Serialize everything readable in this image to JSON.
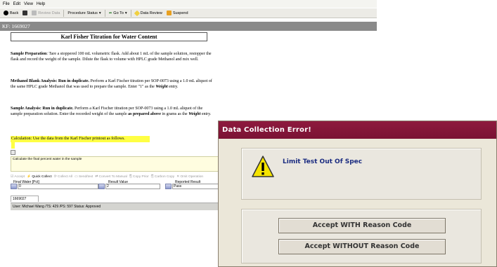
{
  "app": {
    "menu": [
      "File",
      "Edit",
      "View",
      "Help"
    ],
    "toolbar": {
      "back": "Back",
      "reviewdata": "Review Data",
      "procedure_status": "Procedure Status",
      "goto": "Go To",
      "data_review": "Data Review",
      "suspend": "Suspend"
    },
    "record_id": "KF: 1669027",
    "doc_title": "Karl Fisher Titration for Water Content",
    "sections": {
      "sample_prep_head": "Sample Preparation",
      "sample_prep_body": ":  Tare a stoppered 100 mL volumetric flask.  Add about 1 mL of the sample solution, restopper the flask and record the weight of the sample.  Dilute the flask to volume with HPLC grade Methanol and mix well.",
      "blank_head": "Methanol Blank Analysis:  Run in duplicate.",
      "blank_body_1": "  Perform a Karl Fischer titration per SOP-0073 using a 1.0 mL aliquot of the same HPLC grade Methanol that was used to prepare the sample. Enter \"1\" as the ",
      "blank_weight": "Weight",
      "blank_body_2": " entry.",
      "analysis_head": "Sample Analysis:  Run in duplicate.",
      "analysis_body_1": "  Perform a Karl Fischer titration per SOP-0073 using a 1.0 mL aliquot of the sample preparation solution.  Enter the recorded weight of the sample ",
      "analysis_as": "as prepared above",
      "analysis_body_2": " in grams as the ",
      "analysis_weight": "Weight",
      "analysis_body_3": " entry."
    },
    "calculation": "Calculation:  Use the data from the Karl Fischer printout as follows.",
    "prompt": "Calculate the final percent water in the sample",
    "data_toolbar": {
      "accept": "Accept",
      "quick_collect": "Quick Collect",
      "collect_all": "Collect All",
      "sendtext": "Send/text",
      "convert": "Convert To Manual",
      "copy_prior": "Copy Prior",
      "carbon_copy": "Carbon Copy",
      "omit": "Omit Operation"
    },
    "fields": [
      {
        "label": "Final Water [Pct]",
        "value": "0"
      },
      {
        "label": "Result Value",
        "value": "2"
      },
      {
        "label": "Reported Result",
        "value": "Pass"
      }
    ],
    "tab": "1669027",
    "status": "User: Michael Wang  /TS: 429  /PS: 597  Status:  Approved"
  },
  "dialog": {
    "title": "Data Collection Error!",
    "message": "Limit Test Out Of Spec",
    "accept_with": "Accept WITH Reason Code",
    "accept_without": "Accept WITHOUT Reason Code",
    "colors": {
      "title_bar": "#7e1438",
      "message": "#1a2b80",
      "warning": "#f5e400"
    }
  }
}
